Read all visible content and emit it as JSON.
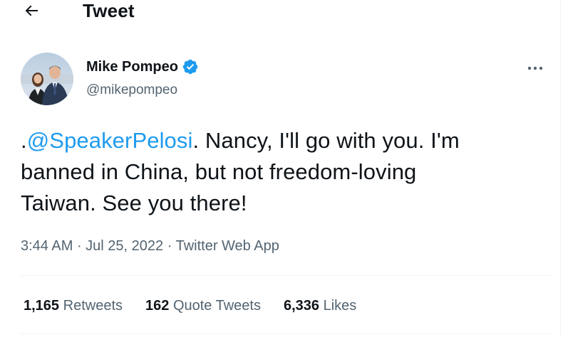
{
  "header": {
    "title": "Tweet",
    "back_icon": "arrow-left-icon"
  },
  "author": {
    "name": "Mike Pompeo",
    "handle": "@mikepompeo",
    "verified_icon": "verified-badge-icon",
    "more_icon": "more-horizontal-icon"
  },
  "tweet": {
    "prefix": ".",
    "mention": "@SpeakerPelosi",
    "text_after_mention": ". Nancy, I'll go with you. I'm\nbanned in China, but not freedom-loving\nTaiwan.  See you there!"
  },
  "meta": {
    "time": "3:44 AM",
    "sep1": " · ",
    "date": "Jul 25, 2022",
    "sep2": " · ",
    "source": "Twitter Web App"
  },
  "stats": [
    {
      "value": "1,165",
      "label": "Retweets"
    },
    {
      "value": "162",
      "label": "Quote Tweets"
    },
    {
      "value": "6,336",
      "label": "Likes"
    }
  ],
  "colors": {
    "accent": "#1d9bf0",
    "text_primary": "#0f1419",
    "text_secondary": "#536471",
    "divider": "#eff3f4"
  }
}
